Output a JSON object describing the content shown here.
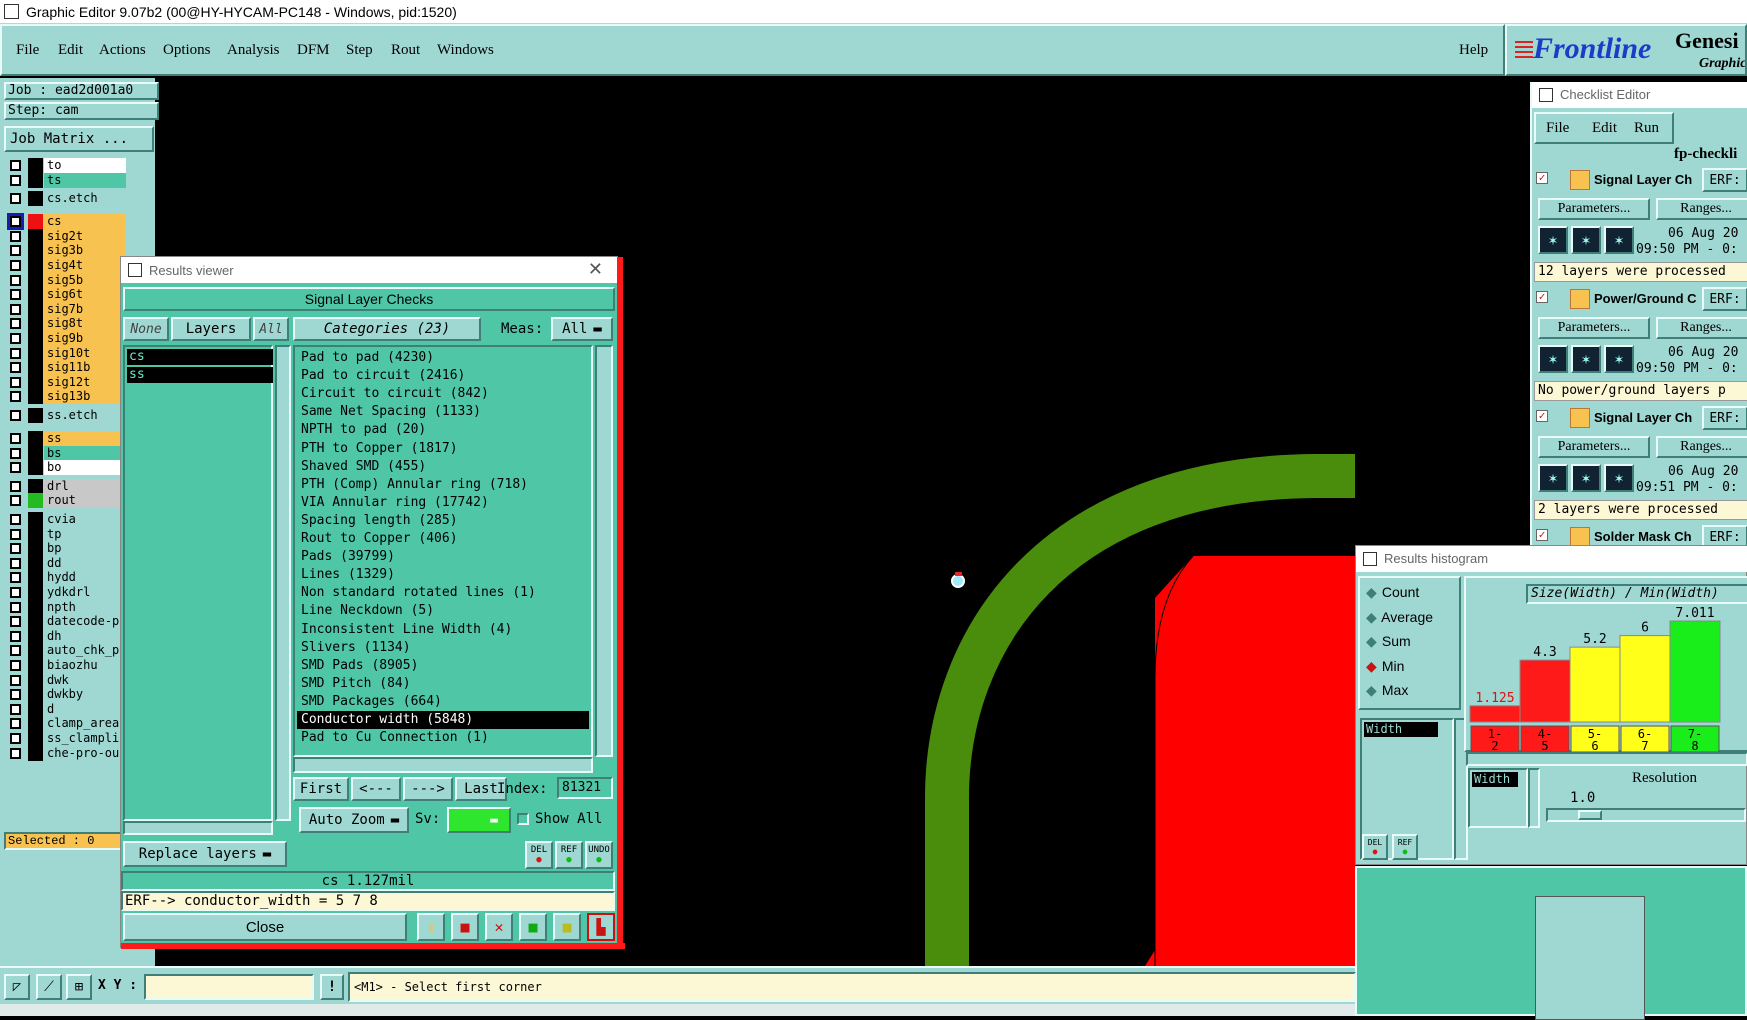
{
  "window_title": "Graphic Editor 9.07b2 (00@HY-HYCAM-PC148 - Windows, pid:1520)",
  "menu": [
    "File",
    "Edit",
    "Actions",
    "Options",
    "Analysis",
    "DFM",
    "Step",
    "Rout",
    "Windows"
  ],
  "help": "Help",
  "brand": {
    "logo": "Frontline",
    "product": "Genesi",
    "sub": "Graphic"
  },
  "job": "Job : ead2d001a0",
  "step": "Step: cam",
  "job_matrix": "Job Matrix ...",
  "layers": [
    {
      "name": "to",
      "color": "w"
    },
    {
      "name": "ts",
      "color": "g"
    },
    {
      "name": "cs.etch",
      "color": "c"
    },
    {
      "name": "cs",
      "color": "y"
    },
    {
      "name": "sig2t",
      "color": "y"
    },
    {
      "name": "sig3b",
      "color": "y"
    },
    {
      "name": "sig4t",
      "color": "y"
    },
    {
      "name": "sig5b",
      "color": "y"
    },
    {
      "name": "sig6t",
      "color": "y"
    },
    {
      "name": "sig7b",
      "color": "y"
    },
    {
      "name": "sig8t",
      "color": "y"
    },
    {
      "name": "sig9b",
      "color": "y"
    },
    {
      "name": "sig10t",
      "color": "y"
    },
    {
      "name": "sig11b",
      "color": "y"
    },
    {
      "name": "sig12t",
      "color": "y"
    },
    {
      "name": "sig13b",
      "color": "y"
    },
    {
      "name": "ss.etch",
      "color": "c"
    },
    {
      "name": "ss",
      "color": "y"
    },
    {
      "name": "bs",
      "color": "g"
    },
    {
      "name": "bo",
      "color": "w"
    },
    {
      "name": "drl",
      "color": "gr"
    },
    {
      "name": "rout",
      "color": "gr"
    },
    {
      "name": "cvia",
      "color": "c"
    },
    {
      "name": "tp",
      "color": "c"
    },
    {
      "name": "bp",
      "color": "c"
    },
    {
      "name": "dd",
      "color": "c"
    },
    {
      "name": "hydd",
      "color": "c"
    },
    {
      "name": "ydkdrl",
      "color": "c"
    },
    {
      "name": "npth",
      "color": "c"
    },
    {
      "name": "datecode-pt",
      "color": "c"
    },
    {
      "name": "dh",
      "color": "c"
    },
    {
      "name": "auto_chk_pn",
      "color": "c"
    },
    {
      "name": "biaozhu",
      "color": "c"
    },
    {
      "name": "dwk",
      "color": "c"
    },
    {
      "name": "dwkby",
      "color": "c"
    },
    {
      "name": "d",
      "color": "c"
    },
    {
      "name": "clamp_area",
      "color": "c"
    },
    {
      "name": "ss_clamplin",
      "color": "c"
    },
    {
      "name": "che-pro-out",
      "color": "c"
    }
  ],
  "selected": "Selected : 0",
  "results_viewer": {
    "title": "Results viewer",
    "header": "Signal Layer Checks",
    "none": "None",
    "layers": "Layers",
    "all": "All",
    "categories": "Categories (23)",
    "meas_label": "Meas:",
    "meas_value": "All",
    "layer_list": [
      "cs",
      "ss"
    ],
    "category_list": [
      "Pad to pad (4230)",
      "Pad to circuit (2416)",
      "Circuit to circuit (842)",
      "Same Net Spacing (1133)",
      "NPTH to pad (20)",
      "PTH to Copper (1817)",
      "Shaved SMD (455)",
      "PTH (Comp) Annular ring (718)",
      "VIA Annular ring (17742)",
      "Spacing length (285)",
      "Rout to Copper (406)",
      "Pads (39799)",
      "Lines (1329)",
      "Non standard rotated lines (1)",
      "Line Neckdown (5)",
      "Inconsistent Line Width (4)",
      "Slivers (1134)",
      "SMD Pads (8905)",
      "SMD Pitch (84)",
      "SMD Packages (664)",
      "Conductor width (5848)",
      "Pad to Cu Connection (1)"
    ],
    "first": "First",
    "prev": "<---",
    "next": "--->",
    "last": "Last",
    "index_label": "Index:",
    "index_value": "81321",
    "auto_zoom": "Auto Zoom",
    "sv_label": "Sv:",
    "show_all": "Show All",
    "replace_layers": "Replace layers",
    "del": "DEL",
    "ref": "REF",
    "undo": "UNDO",
    "measure": "cs 1.127mil",
    "erf": "ERF--> conductor_width = 5 7 8",
    "close": "Close"
  },
  "checklist": {
    "title": "Checklist Editor",
    "menu": [
      "File",
      "Edit",
      "Run"
    ],
    "name": "fp-checkli",
    "items": [
      {
        "name": "Signal Layer Ch",
        "erf": "ERF:",
        "params": "Parameters...",
        "ranges": "Ranges...",
        "date": "06 Aug 20",
        "time": "09:50 PM - 0:",
        "msg": "12 layers were processed"
      },
      {
        "name": "Power/Ground C",
        "erf": "ERF:",
        "params": "Parameters...",
        "ranges": "Ranges...",
        "date": "06 Aug 20",
        "time": "09:50 PM - 0:",
        "msg": "No power/ground layers p"
      },
      {
        "name": "Signal Layer Ch",
        "erf": "ERF:",
        "params": "Parameters...",
        "ranges": "Ranges...",
        "date": "06 Aug 20",
        "time": "09:51 PM - 0:",
        "msg": "2 layers were processed"
      },
      {
        "name": "Solder Mask Ch",
        "erf": "ERF:"
      }
    ]
  },
  "histogram": {
    "title": "Results histogram",
    "modes": [
      "Count",
      "Average",
      "Sum",
      "Min",
      "Max"
    ],
    "selected_mode": "Min",
    "list_item": "Width",
    "chart_title": "Size(Width) / Min(Width)",
    "resolution_label": "Resolution",
    "resolution_value": "1.0",
    "res_list_item": "Width",
    "del": "DEL",
    "ref": "REF"
  },
  "chart_data": {
    "type": "bar",
    "title": "Size(Width) / Min(Width)",
    "categories": [
      "1-\n2",
      "4-\n5",
      "5-\n6",
      "6-\n7",
      "7-\n8"
    ],
    "values": [
      1.125,
      4.3,
      5.2,
      6,
      7.011
    ],
    "value_labels": [
      "1.125",
      "4.3",
      "5.2",
      "6",
      "7.011"
    ],
    "colors": [
      "#ff1a1a",
      "#ff1a1a",
      "#ffff1a",
      "#ffff1a",
      "#1aee1a"
    ],
    "ylim": [
      0,
      7.5
    ]
  },
  "status": {
    "xy_label": "X Y :",
    "xy_value": "",
    "prompt": "<M1> - Select first corner"
  },
  "colors": {
    "panel": "#9fd8d3",
    "list": "#4fc7a7",
    "trace": "#4a8c0c",
    "pad": "#ff0000"
  }
}
